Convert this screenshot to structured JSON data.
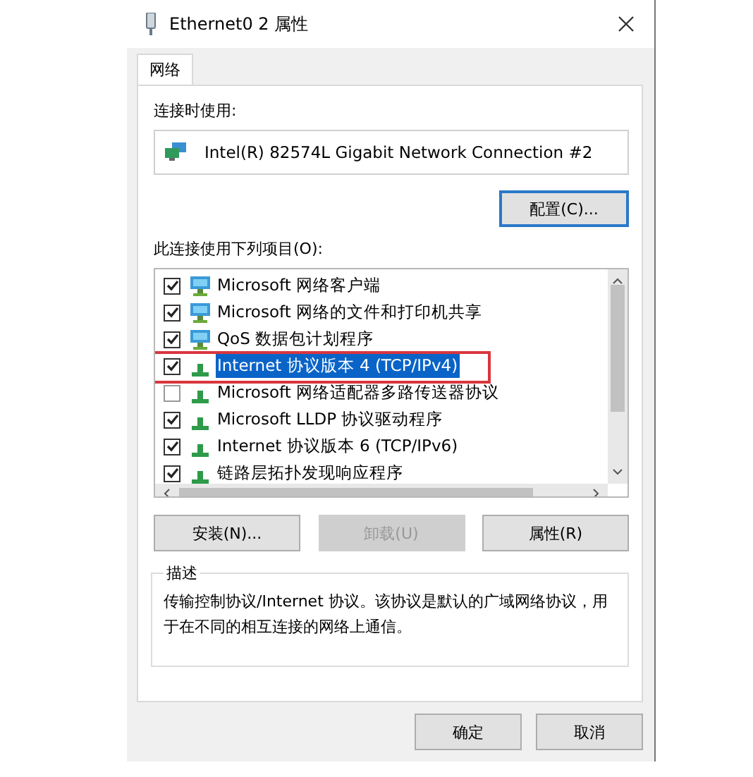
{
  "window": {
    "title": "Ethernet0 2 属性"
  },
  "tabs": [
    {
      "label": "网络",
      "selected": true
    }
  ],
  "connect_using": {
    "label": "连接时使用:",
    "adapter": "Intel(R) 82574L Gigabit Network Connection #2",
    "configure_button": "配置(C)..."
  },
  "items_label": "此连接使用下列项目(O):",
  "items": [
    {
      "kind": "client",
      "label": "Microsoft 网络客户端",
      "checked": true,
      "selected": false,
      "highlighted": false
    },
    {
      "kind": "client",
      "label": "Microsoft 网络的文件和打印机共享",
      "checked": true,
      "selected": false,
      "highlighted": false
    },
    {
      "kind": "client",
      "label": "QoS 数据包计划程序",
      "checked": true,
      "selected": false,
      "highlighted": false
    },
    {
      "kind": "protocol",
      "label": "Internet 协议版本 4 (TCP/IPv4)",
      "checked": true,
      "selected": true,
      "highlighted": true
    },
    {
      "kind": "protocol",
      "label": "Microsoft 网络适配器多路传送器协议",
      "checked": false,
      "selected": false,
      "highlighted": false
    },
    {
      "kind": "protocol",
      "label": "Microsoft LLDP 协议驱动程序",
      "checked": true,
      "selected": false,
      "highlighted": false
    },
    {
      "kind": "protocol",
      "label": "Internet 协议版本 6 (TCP/IPv6)",
      "checked": true,
      "selected": false,
      "highlighted": false
    },
    {
      "kind": "protocol",
      "label": "链路层拓扑发现响应程序",
      "checked": true,
      "selected": false,
      "highlighted": false
    }
  ],
  "buttons": [
    {
      "label": "安装(N)...",
      "disabled": false
    },
    {
      "label": "卸载(U)",
      "disabled": true
    },
    {
      "label": "属性(R)",
      "disabled": false
    }
  ],
  "description": {
    "legend": "描述",
    "text": "传输控制协议/Internet 协议。该协议是默认的广域网络协议，用于在不同的相互连接的网络上通信。"
  },
  "footer_buttons": [
    {
      "label": "确定"
    },
    {
      "label": "取消"
    }
  ]
}
